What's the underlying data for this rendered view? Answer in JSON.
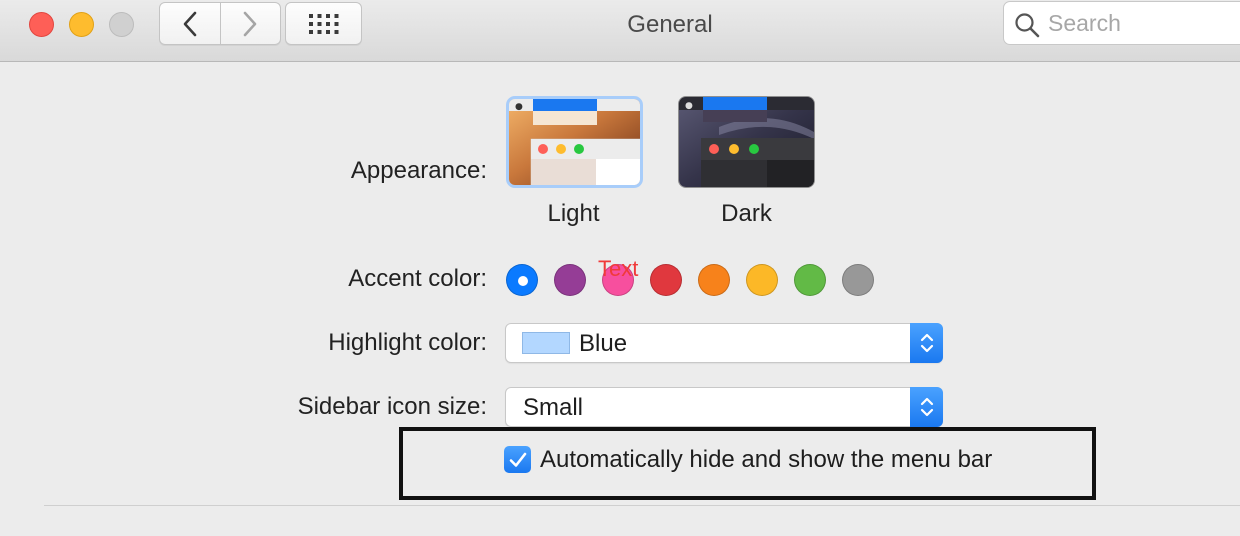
{
  "window": {
    "title": "General",
    "search": {
      "placeholder": "Search",
      "value": ""
    }
  },
  "appearance": {
    "label": "Appearance:",
    "options": [
      {
        "label": "Light",
        "selected": true
      },
      {
        "label": "Dark",
        "selected": false
      }
    ]
  },
  "accent": {
    "label": "Accent color:",
    "overlay_text": "Text",
    "colors": [
      {
        "name": "blue",
        "hex": "#0a7aff",
        "selected": true
      },
      {
        "name": "purple",
        "hex": "#953d96",
        "selected": false
      },
      {
        "name": "pink",
        "hex": "#f74f9e",
        "selected": false
      },
      {
        "name": "red",
        "hex": "#e0383e",
        "selected": false
      },
      {
        "name": "orange",
        "hex": "#f7821b",
        "selected": false
      },
      {
        "name": "yellow",
        "hex": "#fcb827",
        "selected": false
      },
      {
        "name": "green",
        "hex": "#62ba46",
        "selected": false
      },
      {
        "name": "graphite",
        "hex": "#989898",
        "selected": false
      }
    ]
  },
  "highlight": {
    "label": "Highlight color:",
    "value": "Blue",
    "swatch_color": "#b3d7ff"
  },
  "sidebar_icon_size": {
    "label": "Sidebar icon size:",
    "value": "Small"
  },
  "menu_bar": {
    "label": "Automatically hide and show the menu bar",
    "checked": true
  }
}
